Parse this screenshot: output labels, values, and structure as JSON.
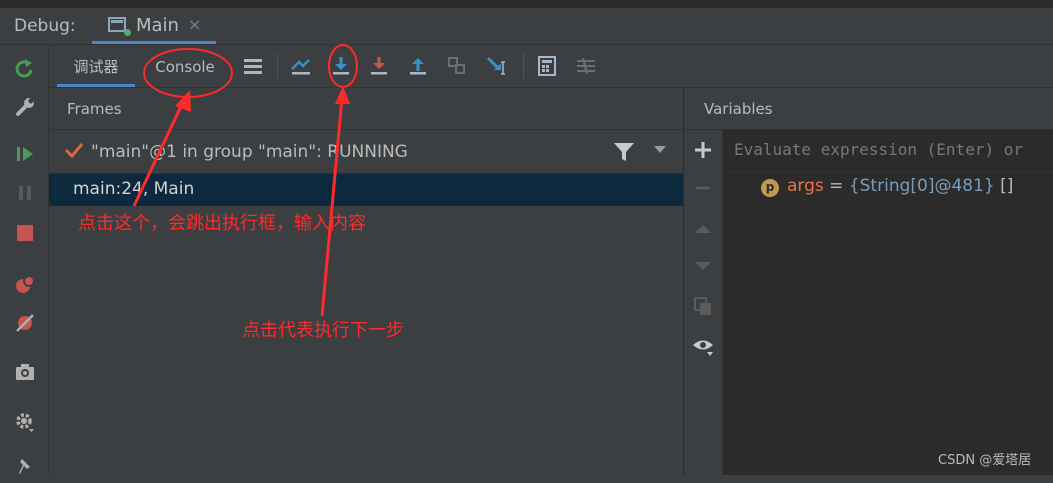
{
  "header": {
    "debug_label": "Debug:",
    "main_tab_label": "Main",
    "close_glyph": "×"
  },
  "toolbar": {
    "tab_debugger": "调试器",
    "tab_console": "Console"
  },
  "frames": {
    "title": "Frames",
    "thread_text": "\"main\"@1 in group \"main\": RUNNING",
    "selected_frame": "main:24, Main"
  },
  "variables": {
    "title": "Variables",
    "eval_placeholder": "Evaluate expression (Enter) or",
    "items": [
      {
        "badge": "p",
        "name": "args",
        "eq": " = ",
        "value": "{String[0]@481}",
        "extra": " []"
      }
    ]
  },
  "annotations": {
    "console_note": "点击这个，会跳出执行框，输入内容",
    "step_note": "点击代表执行下一步"
  },
  "watermark": "CSDN @爱塔居",
  "colors": {
    "background": "#3c3f41",
    "editor_bg": "#2b2b2b",
    "selection": "#0d293e",
    "accent_blue": "#4a88c7",
    "annotation_red": "#ff2a2a"
  }
}
